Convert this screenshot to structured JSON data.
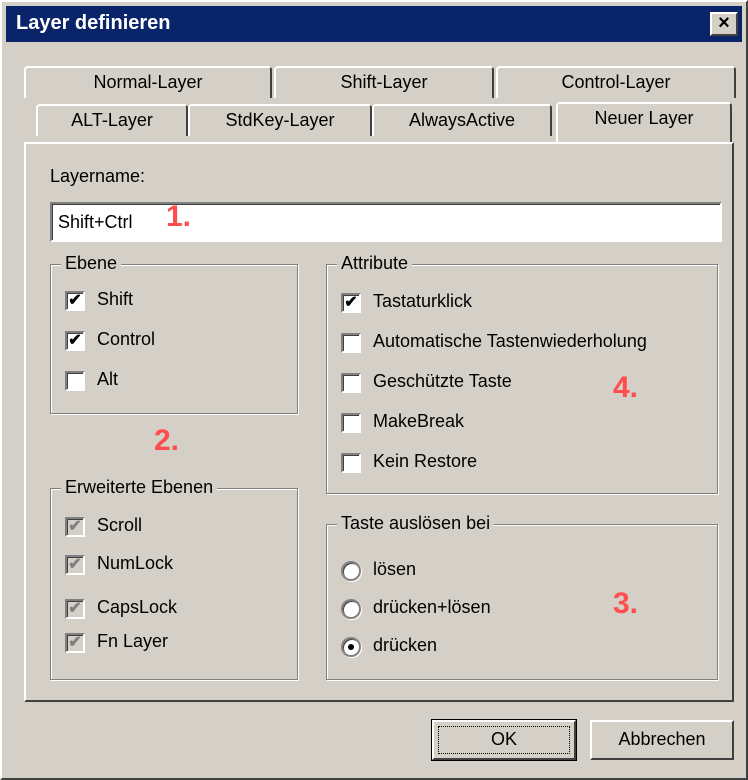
{
  "window": {
    "title": "Layer definieren",
    "close_glyph": "×"
  },
  "tabs": {
    "back_row": [
      "Normal-Layer",
      "Shift-Layer",
      "Control-Layer"
    ],
    "front_row": [
      "ALT-Layer",
      "StdKey-Layer",
      "AlwaysActive"
    ],
    "active": "Neuer Layer"
  },
  "layername": {
    "label": "Layername:",
    "value": "Shift+Ctrl"
  },
  "ebene": {
    "legend": "Ebene",
    "items": [
      {
        "label": "Shift",
        "checked": "✔"
      },
      {
        "label": "Control",
        "checked": "✔"
      },
      {
        "label": "Alt",
        "checked": ""
      }
    ]
  },
  "erweiterte": {
    "legend": "Erweiterte Ebenen",
    "items": [
      {
        "label": "Scroll",
        "checked": "✔"
      },
      {
        "label": "NumLock",
        "checked": "✔"
      },
      {
        "label": "CapsLock",
        "checked": "✔"
      },
      {
        "label": "Fn Layer",
        "checked": "✔"
      }
    ]
  },
  "attribute": {
    "legend": "Attribute",
    "items": [
      {
        "label": "Tastaturklick",
        "checked": "✔"
      },
      {
        "label": "Automatische Tastenwiederholung",
        "checked": ""
      },
      {
        "label": "Geschützte Taste",
        "checked": ""
      },
      {
        "label": "MakeBreak",
        "checked": ""
      },
      {
        "label": "Kein Restore",
        "checked": ""
      }
    ]
  },
  "trigger": {
    "legend": "Taste auslösen bei",
    "options": [
      "lösen",
      "drücken+lösen",
      "drücken"
    ],
    "selected": "drücken"
  },
  "annotations": [
    "1.",
    "2.",
    "3.",
    "4."
  ],
  "buttons": {
    "ok": "OK",
    "cancel": "Abbrechen"
  },
  "colors": {
    "titlebar": "#0a246a",
    "face": "#d4d0c8",
    "annotation": "#ff4c4c"
  }
}
